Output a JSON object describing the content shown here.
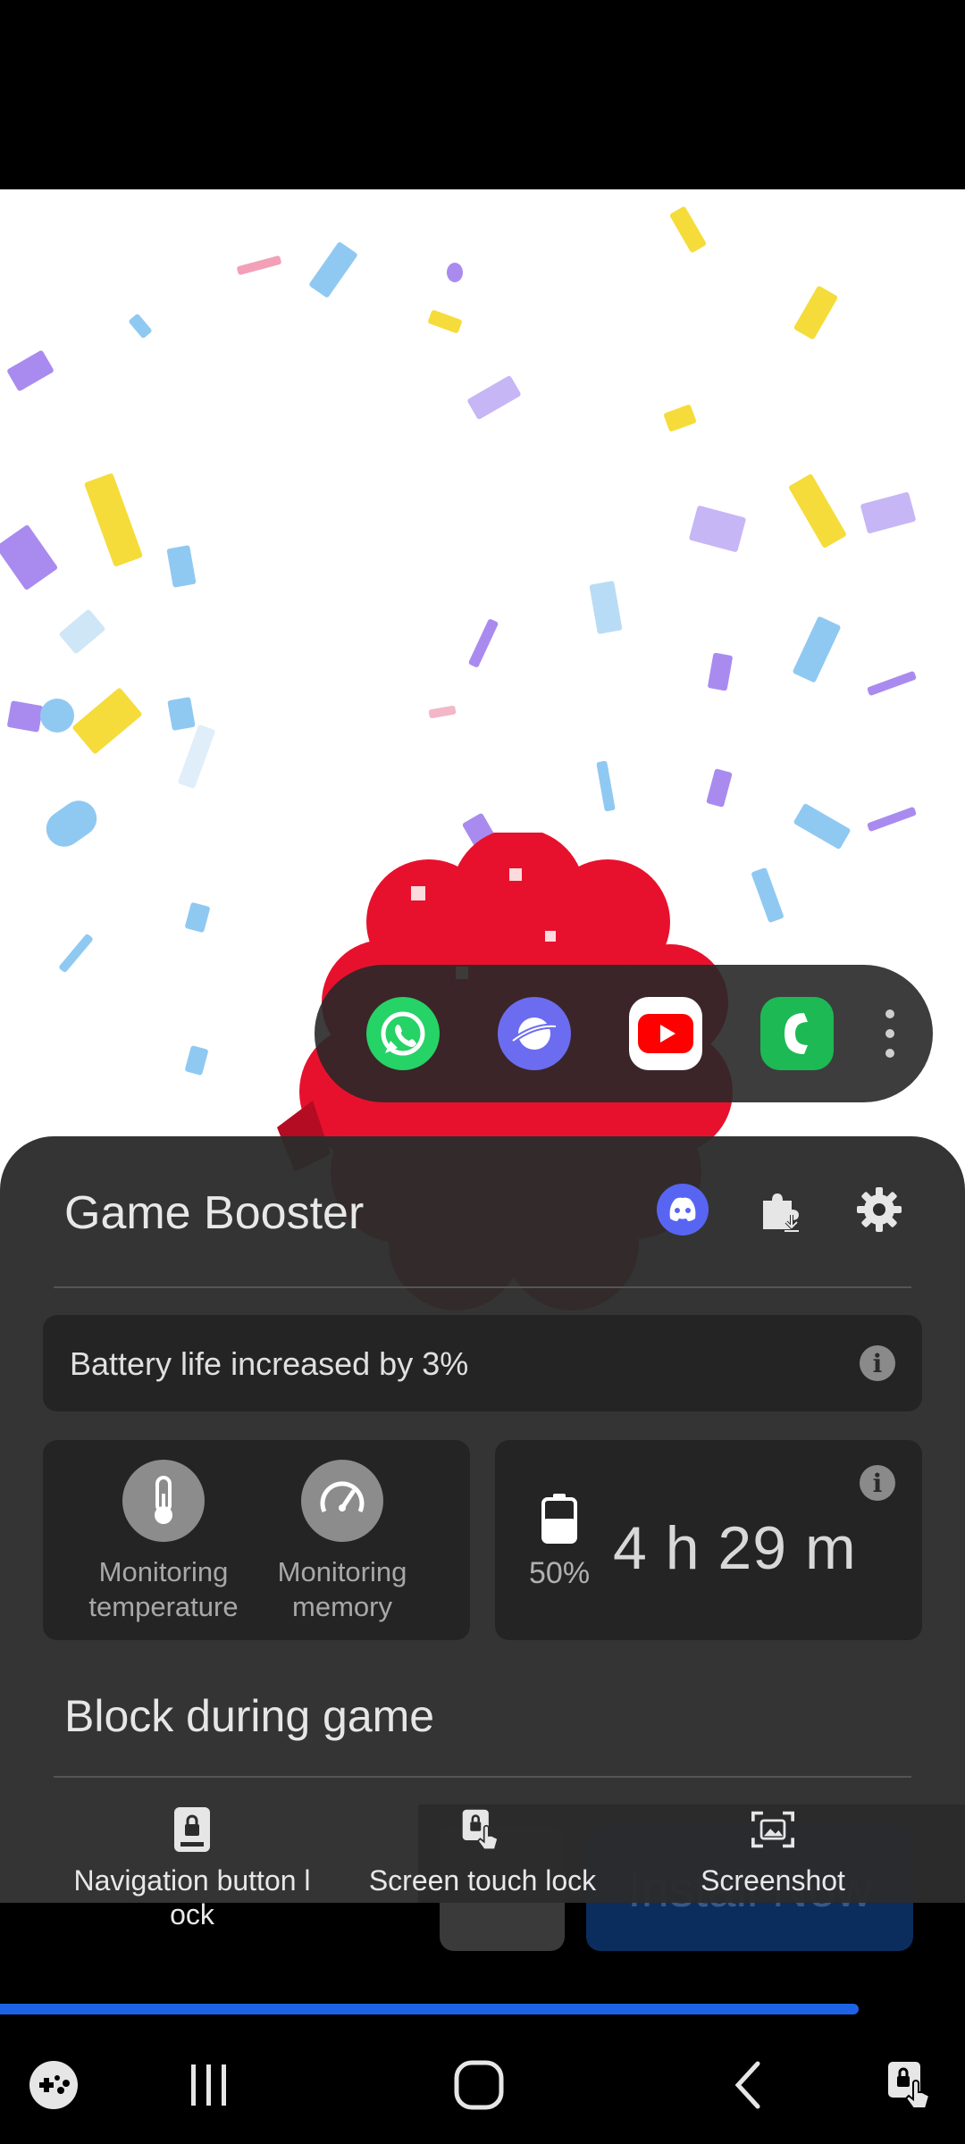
{
  "app_tray": {
    "apps": [
      {
        "name": "whatsapp-icon",
        "color": "#25D366"
      },
      {
        "name": "samsung-internet-icon",
        "color": "#6C6CF0"
      },
      {
        "name": "youtube-icon",
        "color": "#FF0000"
      },
      {
        "name": "phone-icon",
        "color": "#1DB954"
      }
    ],
    "more_icon": "more-vertical-icon"
  },
  "ad": {
    "button_label": "Install Now"
  },
  "game_booster": {
    "title": "Game Booster",
    "header_icons": [
      "discord-icon",
      "plugin-download-icon",
      "settings-gear-icon"
    ],
    "battery_message": "Battery life increased by 3%",
    "monitoring": [
      {
        "label": "Monitoring temperature",
        "icon": "thermometer-icon"
      },
      {
        "label": "Monitoring memory",
        "icon": "speedometer-icon"
      }
    ],
    "battery_percent": "50%",
    "time_remaining": "4 h 29 m",
    "block_section_title": "Block during game",
    "tools": [
      {
        "label": "Navigation button l ock",
        "icon": "navigation-lock-icon"
      },
      {
        "label": "Screen touch lock",
        "icon": "touch-lock-icon"
      },
      {
        "label": "Screenshot",
        "icon": "screenshot-icon"
      }
    ]
  },
  "progress": {
    "value": 0.89,
    "color": "#1E63E6"
  },
  "navbar": {
    "buttons": [
      "game-launcher-icon",
      "recent-apps-icon",
      "home-icon",
      "back-icon",
      "touch-lock-nav-icon"
    ]
  }
}
